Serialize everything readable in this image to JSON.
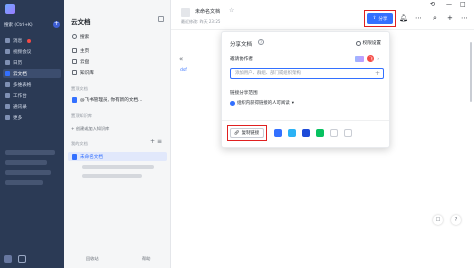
{
  "colors": {
    "accent": "#3370ff",
    "nav_bg": "#2b3a55",
    "highlight": "#e02020",
    "alert": "#f54a45"
  },
  "leftnav": {
    "search_label": "搜索 (Ctrl+K)",
    "items": [
      {
        "label": "消息",
        "icon": "chat-icon"
      },
      {
        "label": "视频会议",
        "icon": "video-icon"
      },
      {
        "label": "日历",
        "icon": "calendar-icon"
      },
      {
        "label": "云文档",
        "icon": "cloud-doc-icon"
      },
      {
        "label": "多维表格",
        "icon": "table-icon"
      },
      {
        "label": "工作台",
        "icon": "workspace-icon"
      },
      {
        "label": "通讯录",
        "icon": "contacts-icon"
      },
      {
        "label": "更多",
        "icon": "more-icon"
      }
    ]
  },
  "docside": {
    "title": "云文档",
    "search": "搜索",
    "home": "主页",
    "cloud": "云盘",
    "wiki": "知识库",
    "pinned_section": "置顶文档",
    "pinned_item": "@飞书管理员, 你有新的文档...",
    "wiki_section": "置顶知识库",
    "new_wiki": "+ 创建或加入知识库",
    "my_section": "我的文档",
    "active_doc": "未命名文档",
    "bottom_left": "回收站",
    "bottom_right": "帮助"
  },
  "topbar": {
    "doc_title": "未命名文档",
    "doc_sub": "最近修改: 昨天 23:25",
    "share_label": "分享"
  },
  "content": {
    "back": "«",
    "text": "dsf"
  },
  "popover": {
    "title": "分享文档",
    "permission": "权限设置",
    "invite_label": "邀请协作者",
    "avatar_letter": "飞",
    "input_placeholder": "添加用户、群组、部门或组织架构",
    "scope_label": "链接分享范围",
    "scope_value": "组织内获得链接的人可阅读",
    "copy_link": "复制链接"
  }
}
